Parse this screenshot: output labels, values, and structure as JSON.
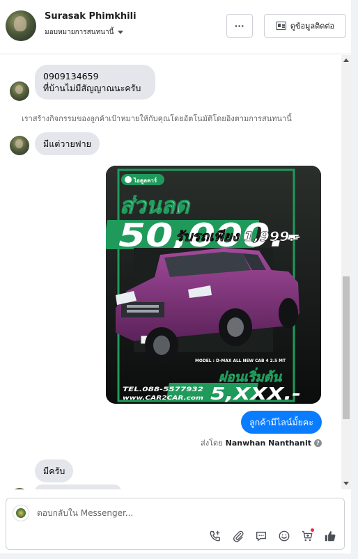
{
  "header": {
    "contact_name": "Surasak Phimkhili",
    "assign_label": "มอบหมายการสนทนานี้",
    "more_label": "···",
    "contact_info_label": "ดูข้อมูลติดต่อ"
  },
  "messages": {
    "m1_line1": "0909134659",
    "m1_line2": "ที่บ้านไม่มีสัญญาณนะครับ",
    "system_note": "เราสร้างกิจกรรมของลูกค้าเป้าหมายให้กับคุณโดยอัตโนมัติโดยอิงตามการสนทนานี้",
    "m2": "มีแต่วายฟาย",
    "out1": "ลูกค้ามีไลน์มั้ยคะ",
    "sent_by_prefix": "ส่งโดย",
    "sent_by_name": "Nanwhan Nanthanit",
    "m3": "มีครับ"
  },
  "promo": {
    "brand": "ไอคูลคาร์",
    "headline": "ส่วนลด",
    "discount": "50,000.-",
    "down_payment": "รับรถเพียง 1,999.-",
    "model_note": "MODEL : D-MAX ALL NEW CAB 4 2.5 MT",
    "installment_label": "ผ่อนเริ่มต้น",
    "installment_value": "5,XXX.-",
    "phone": "TEL.088-5577932",
    "website": "www.CAR2CAR.com",
    "accent_color": "#1f9a5b",
    "car_color": "#8a3a86"
  },
  "composer": {
    "placeholder": "ตอบกลับใน Messenger...",
    "icons": [
      "phone-add-icon",
      "attachment-icon",
      "saved-reply-icon",
      "emoji-icon",
      "cart-icon",
      "like-icon"
    ]
  }
}
